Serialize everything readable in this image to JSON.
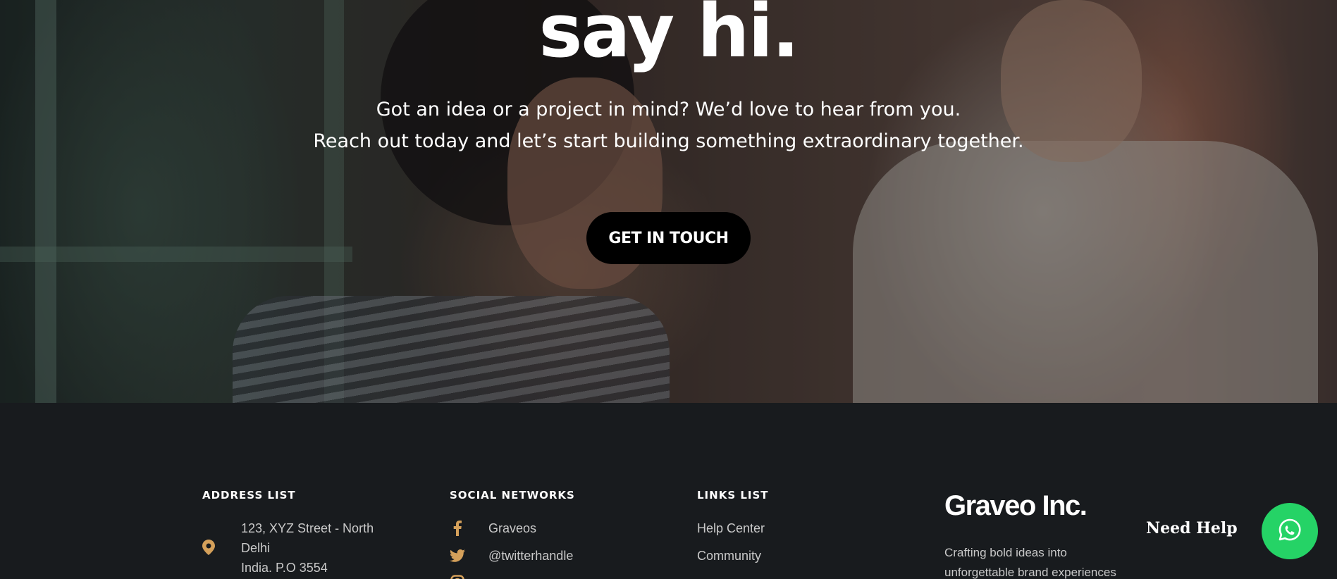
{
  "hero": {
    "title": "say hi.",
    "line1": "Got an idea or a project in mind? We’d love to hear from you.",
    "line2": "Reach out today and let’s start building something extraordinary together.",
    "cta_label": "GET IN TOUCH"
  },
  "footer": {
    "address": {
      "title": "ADDRESS LIST",
      "lines": [
        "123, XYZ Street - North",
        "Delhi",
        "India. P.O 3554"
      ]
    },
    "social": {
      "title": "SOCIAL NETWORKS",
      "items": [
        {
          "label": "Graveos",
          "icon": "facebook-icon"
        },
        {
          "label": "@twitterhandle",
          "icon": "twitter-icon"
        },
        {
          "label": "",
          "icon": "instagram-icon"
        }
      ]
    },
    "links": {
      "title": "LINKS LIST",
      "items": [
        "Help Center",
        "Community",
        ""
      ]
    },
    "brand": {
      "name": "Graveo Inc.",
      "description": "Crafting bold ideas into unforgettable brand experiences"
    }
  },
  "help_widget": {
    "label": "Need Help",
    "icon": "whatsapp-icon"
  },
  "colors": {
    "accent": "#d4a05a",
    "footer_bg": "#181b1e",
    "whatsapp": "#25d366"
  }
}
